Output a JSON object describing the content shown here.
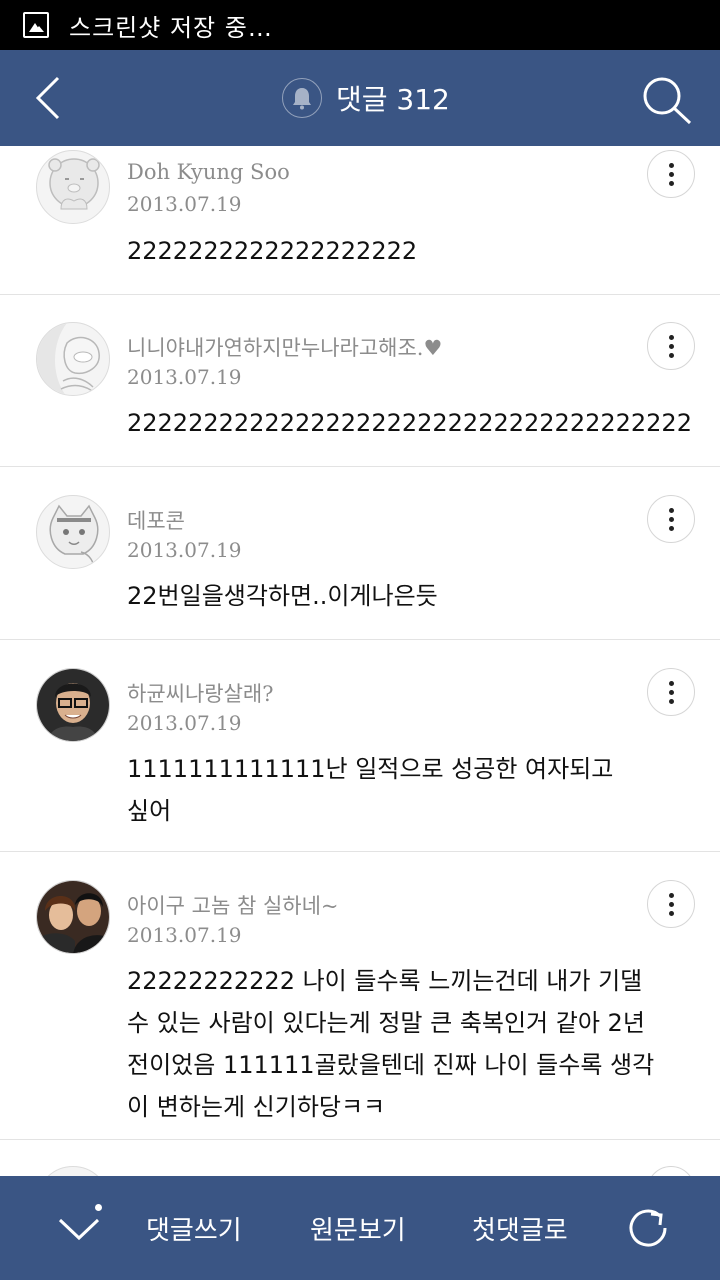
{
  "status_bar": {
    "text": "스크린샷 저장 중…"
  },
  "header": {
    "title": "댓글 312"
  },
  "comments": [
    {
      "author": "Doh Kyung Soo",
      "date": "2013.07.19",
      "text": "2222222222222222222"
    },
    {
      "author": "니니야내가연하지만누나라고해조.♥",
      "date": "2013.07.19",
      "text": "2222222222222222222222222222222222222"
    },
    {
      "author": "데포콘",
      "date": "2013.07.19",
      "text": "22번일을생각하면..이게나은듯"
    },
    {
      "author": "하균씨나랑살래?",
      "date": "2013.07.19",
      "text": "1111111111111난 일적으로 성공한 여자되고 싶어"
    },
    {
      "author": "아이구 고놈 참 실하네~",
      "date": "2013.07.19",
      "text": "22222222222 나이 들수록 느끼는건데 내가 기댈 수 있는 사람이 있다는게 정말 큰 축복인거 같아 2년전이었음 111111골랐을텐데 진짜 나이 들수록 생각이 변하는게 신기하당ㅋㅋ"
    }
  ],
  "bottom_bar": {
    "write": "댓글쓰기",
    "original": "원문보기",
    "first": "첫댓글로"
  },
  "colors": {
    "bar": "#3a5584",
    "meta": "#8c8c8c"
  },
  "icons": [
    "image-icon",
    "back-icon",
    "bell-icon",
    "search-icon",
    "more-icon",
    "chevron-down-icon",
    "refresh-icon"
  ]
}
